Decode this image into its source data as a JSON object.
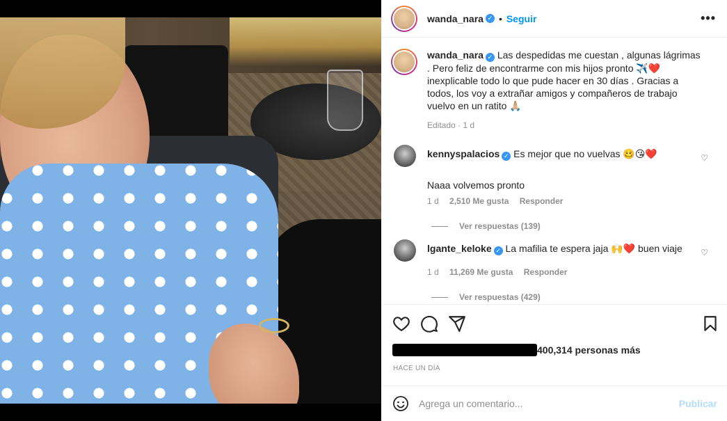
{
  "post": {
    "username": "wanda_nara",
    "follow_label": "Seguir",
    "dot": "•",
    "more_label": "•••",
    "verified_mark": "✓"
  },
  "caption": {
    "username": "wanda_nara",
    "text": "Las despedidas me cuestan , algunas lágrimas . Pero feliz de encontrarme con mis hijos pronto ✈️❤️ inexplicable todo lo que pude hacer en 30 días . Gracias a todos, los voy a extrañar amigos y compañeros de trabajo vuelvo en un ratito 🙏🏼",
    "meta": "Editado · 1 d"
  },
  "comments": [
    {
      "username": "kennyspalacios",
      "text": "Es mejor que no vuelvas 🥴😘❤️",
      "reply_text": "Naaa volvemos pronto",
      "time": "1 d",
      "likes": "2,510 Me gusta",
      "reply_label": "Responder",
      "view_replies": "Ver respuestas (139)"
    },
    {
      "username": "lgante_keloke",
      "text": "La mafilia te espera jaja 🙌❤️ buen viaje",
      "time": "1 d",
      "likes": "11,269 Me gusta",
      "reply_label": "Responder",
      "view_replies": "Ver respuestas (429)"
    }
  ],
  "likes_summary": {
    "text": "400,314 personas más"
  },
  "time_ago": "HACE UN DÍA",
  "add_comment": {
    "placeholder": "Agrega un comentario...",
    "publish_label": "Publicar"
  },
  "colors": {
    "link_blue": "#0095f6",
    "publish_disabled": "#b3dbff",
    "muted": "#8e8e8e",
    "verified": "#3897f0"
  },
  "icons": [
    "heart-icon",
    "comment-icon",
    "share-icon",
    "bookmark-icon",
    "emoji-icon",
    "more-icon"
  ]
}
